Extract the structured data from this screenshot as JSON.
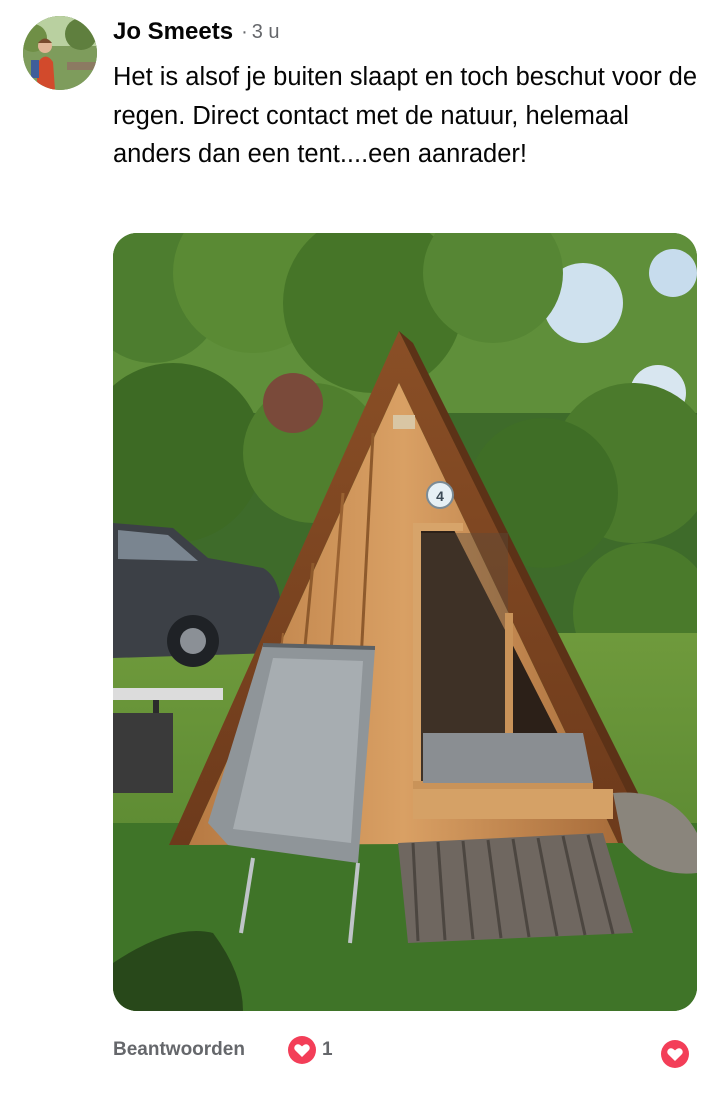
{
  "comment": {
    "author": "Jo Smeets",
    "separator": "·",
    "time": "3 u",
    "text": "Het is alsof je buiten slaapt en toch beschut voor de regen. Direct contact met de natuur, helemaal anders dan een tent....een aanrader!",
    "avatar_icon": "avatar-photo",
    "photo_icon": "a-frame-tent-photo"
  },
  "photo": {
    "sign_number": "4"
  },
  "actions": {
    "reply_label": "Beantwoorden",
    "reaction_count": "1",
    "reaction_icon": "heart-reaction-icon",
    "like_icon": "heart-icon",
    "reaction_color": "#f33e58"
  }
}
